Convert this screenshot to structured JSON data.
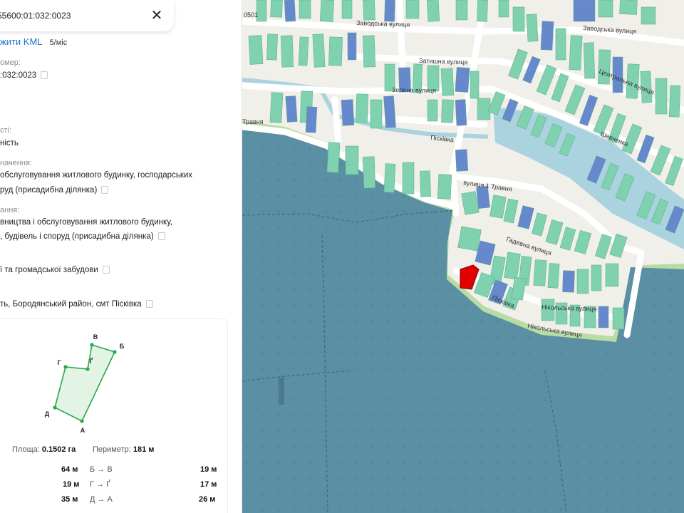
{
  "search": {
    "value": "55600:01:032:0023"
  },
  "panel": {
    "kml_label": "жити KML",
    "kml_price": "5/міс",
    "cad_label": "омер:",
    "cad_value": ":032:0023",
    "own_label": "сті:",
    "own_value": "ність",
    "purpose_label": "начення:",
    "purpose_line1": "обслуговування житлового будинку, господарських",
    "purpose_line2": "руд (присадибна ділянка)",
    "use_label": "ання:",
    "use_line1": "вництва і обслуговування житлового будинку,",
    "use_line2": ", будівель і споруд (присадибна ділянка)",
    "category_value": "ї та громадської забудови",
    "address_value": "ть, Бородянський район, смт Пісківка"
  },
  "plot": {
    "vertices": [
      "В",
      "Б",
      "Г",
      "Ґ",
      "Д",
      "А"
    ],
    "area_label": "Площа:",
    "area_value": "0.1502 га",
    "perimeter_label": "Периметр:",
    "perimeter_value": "181 м",
    "segments": [
      {
        "len": "64 м",
        "name": "Б → В",
        "len2": "19 м"
      },
      {
        "len": "19 м",
        "name": "Г → Ґ",
        "len2": "17 м"
      },
      {
        "len": "35 м",
        "name": "Д → А",
        "len2": "26 м"
      }
    ],
    "colors": {
      "outline": "#2aa84a",
      "fill": "#e3f4e6"
    }
  },
  "map": {
    "streets": [
      "Заводська вулиця",
      "Заводська вулиця",
      "Затишна вулиця",
      "Зелена вулиця",
      "Центральна вулиця",
      "Шевченка",
      "Пісківка",
      "Травня",
      "вулиця 1 Травня",
      "Гадевна вулиця",
      "Пісківка",
      "Нікольська вулиця",
      "Нікольська вулиця"
    ],
    "corner_code": "0501",
    "colors": {
      "land": "#f1efe9",
      "water_blocked": "#5a8fa4",
      "river": "#aad3df",
      "building_green": "#7fd1b0",
      "building_blue": "#6688cc",
      "selected_parcel": "#e00000",
      "shore": "#b9dca5"
    }
  }
}
